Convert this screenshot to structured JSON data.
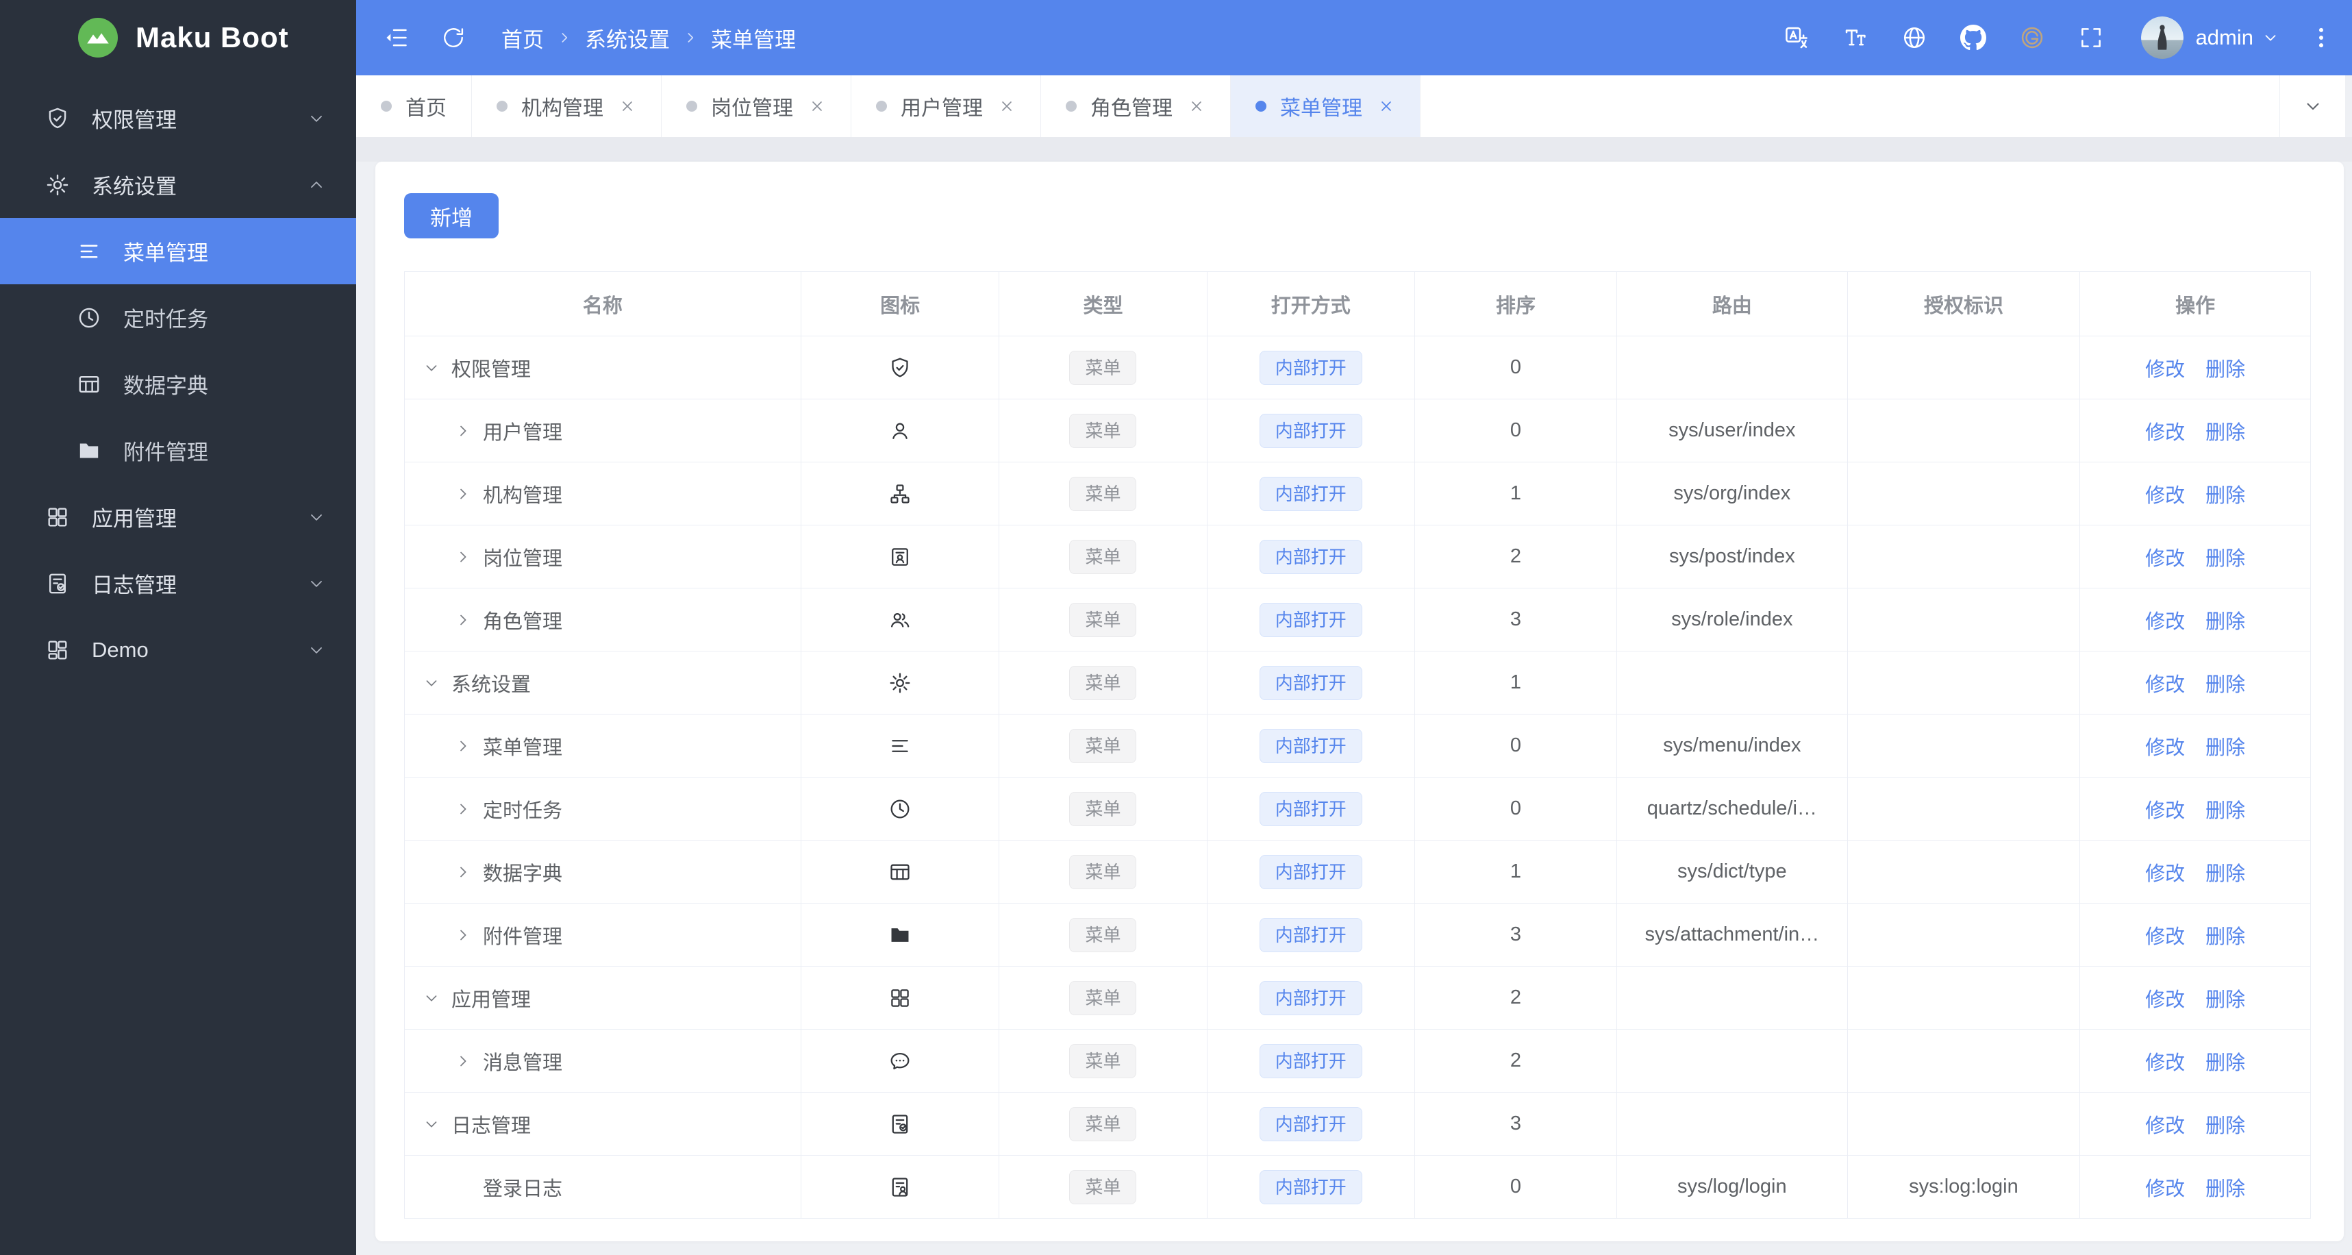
{
  "app": {
    "title": "Maku Boot",
    "logo_icon": "mountain-logo"
  },
  "colors": {
    "accent": "#5585ec",
    "sidebar_bg": "#2a313c",
    "topbar_bg": "#5585ec",
    "active_tab_bg": "#e9effb",
    "logo_green": "#62b956",
    "gitee_icon": "#bfa57e"
  },
  "sidebar": {
    "items": [
      {
        "id": "permission-manage",
        "label": "权限管理",
        "icon": "shield-check",
        "sub": false,
        "expand": "down",
        "active": false
      },
      {
        "id": "system-settings",
        "label": "系统设置",
        "icon": "gear",
        "sub": false,
        "expand": "up",
        "active": false
      },
      {
        "id": "menu-manage",
        "label": "菜单管理",
        "icon": "menu-lines",
        "sub": true,
        "expand": "",
        "active": true
      },
      {
        "id": "scheduled-tasks",
        "label": "定时任务",
        "icon": "clock",
        "sub": true,
        "expand": "",
        "active": false
      },
      {
        "id": "data-dictionary",
        "label": "数据字典",
        "icon": "table-grid",
        "sub": true,
        "expand": "",
        "active": false
      },
      {
        "id": "attachment-manage",
        "label": "附件管理",
        "icon": "folder",
        "sub": true,
        "expand": "",
        "active": false
      },
      {
        "id": "app-manage",
        "label": "应用管理",
        "icon": "app-grid",
        "sub": false,
        "expand": "down",
        "active": false
      },
      {
        "id": "log-manage",
        "label": "日志管理",
        "icon": "doc-check",
        "sub": false,
        "expand": "down",
        "active": false
      },
      {
        "id": "demo",
        "label": "Demo",
        "icon": "demo-grid",
        "sub": false,
        "expand": "down",
        "active": false
      }
    ]
  },
  "topbar": {
    "breadcrumb": [
      "首页",
      "系统设置",
      "菜单管理"
    ],
    "tools": [
      {
        "id": "translate",
        "icon": "translate"
      },
      {
        "id": "text-size",
        "icon": "text-size"
      },
      {
        "id": "globe",
        "icon": "globe"
      },
      {
        "id": "github",
        "icon": "github"
      },
      {
        "id": "gitee",
        "icon": "gitee",
        "tan": true
      },
      {
        "id": "fullscreen",
        "icon": "fullscreen"
      }
    ],
    "user": "admin"
  },
  "tabs": [
    {
      "id": "home",
      "label": "首页",
      "closable": false,
      "active": false
    },
    {
      "id": "org",
      "label": "机构管理",
      "closable": true,
      "active": false
    },
    {
      "id": "post",
      "label": "岗位管理",
      "closable": true,
      "active": false
    },
    {
      "id": "user",
      "label": "用户管理",
      "closable": true,
      "active": false
    },
    {
      "id": "role",
      "label": "角色管理",
      "closable": true,
      "active": false
    },
    {
      "id": "menu",
      "label": "菜单管理",
      "closable": true,
      "active": true
    }
  ],
  "toolbar": {
    "add_label": "新增"
  },
  "table": {
    "columns": [
      "名称",
      "图标",
      "类型",
      "打开方式",
      "排序",
      "路由",
      "授权标识",
      "操作"
    ],
    "col_widths": [
      "20.8%",
      "10.4%",
      "10.9%",
      "10.9%",
      "10.6%",
      "12.1%",
      "12.2%",
      "12.1%"
    ],
    "type_tag": "菜单",
    "open_tag": "内部打开",
    "actions": [
      "修改",
      "删除"
    ],
    "rows": [
      {
        "name": "权限管理",
        "icon": "shield-check",
        "arrow": "down",
        "indent": 0,
        "sort": "0",
        "route": "",
        "auth": ""
      },
      {
        "name": "用户管理",
        "icon": "user",
        "arrow": "right",
        "indent": 1,
        "sort": "0",
        "route": "sys/user/index",
        "auth": ""
      },
      {
        "name": "机构管理",
        "icon": "org",
        "arrow": "right",
        "indent": 1,
        "sort": "1",
        "route": "sys/org/index",
        "auth": ""
      },
      {
        "name": "岗位管理",
        "icon": "id-badge",
        "arrow": "right",
        "indent": 1,
        "sort": "2",
        "route": "sys/post/index",
        "auth": ""
      },
      {
        "name": "角色管理",
        "icon": "users",
        "arrow": "right",
        "indent": 1,
        "sort": "3",
        "route": "sys/role/index",
        "auth": ""
      },
      {
        "name": "系统设置",
        "icon": "gear",
        "arrow": "down",
        "indent": 0,
        "sort": "1",
        "route": "",
        "auth": ""
      },
      {
        "name": "菜单管理",
        "icon": "menu-lines",
        "arrow": "right",
        "indent": 1,
        "sort": "0",
        "route": "sys/menu/index",
        "auth": ""
      },
      {
        "name": "定时任务",
        "icon": "clock",
        "arrow": "right",
        "indent": 1,
        "sort": "0",
        "route": "quartz/schedule/i…",
        "auth": ""
      },
      {
        "name": "数据字典",
        "icon": "table-grid",
        "arrow": "right",
        "indent": 1,
        "sort": "1",
        "route": "sys/dict/type",
        "auth": ""
      },
      {
        "name": "附件管理",
        "icon": "folder",
        "arrow": "right",
        "indent": 1,
        "sort": "3",
        "route": "sys/attachment/in…",
        "auth": ""
      },
      {
        "name": "应用管理",
        "icon": "app-grid",
        "arrow": "down",
        "indent": 0,
        "sort": "2",
        "route": "",
        "auth": ""
      },
      {
        "name": "消息管理",
        "icon": "chat",
        "arrow": "right",
        "indent": 1,
        "sort": "2",
        "route": "",
        "auth": ""
      },
      {
        "name": "日志管理",
        "icon": "doc-check",
        "arrow": "down",
        "indent": 0,
        "sort": "3",
        "route": "",
        "auth": ""
      },
      {
        "name": "登录日志",
        "icon": "doc-user",
        "arrow": "none",
        "indent": 1,
        "sort": "0",
        "route": "sys/log/login",
        "auth": "sys:log:login"
      }
    ]
  }
}
